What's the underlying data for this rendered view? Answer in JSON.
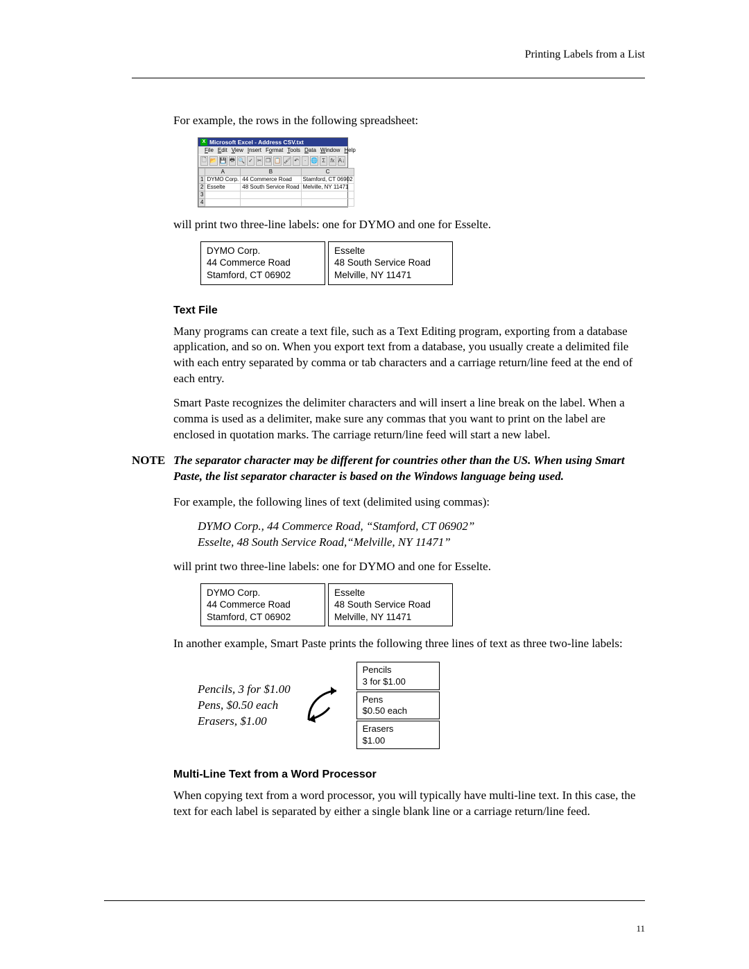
{
  "header": {
    "section_title": "Printing Labels from a List"
  },
  "body": {
    "p1": "For example, the rows in the following spreadsheet:",
    "p2": "will print two three-line labels: one for DYMO and one for Esselte.",
    "textfile_heading": "Text File",
    "p3": "Many programs can create a text file, such as a Text Editing program, exporting from a database application, and so on. When you export text from a database, you usually create a delimited file with each entry separated by comma or tab characters and a carriage return/line feed at the end of each entry.",
    "p4": "Smart Paste recognizes the delimiter characters and will insert a line break on the label. When a comma is used as a delimiter, make sure any commas that you want to print on the label are enclosed in quotation marks. The carriage return/line feed will start a new label.",
    "note_label": "NOTE",
    "note_text": "The separator character may be different for countries other than the US. When using Smart Paste, the list separator character is based on the Windows language being used.",
    "p5": "For example, the following lines of text (delimited using commas):",
    "csv_line1": "DYMO Corp., 44 Commerce Road, “Stamford, CT 06902”",
    "csv_line2": "Esselte, 48 South Service Road,“Melville, NY 11471”",
    "p6": "will print two three-line labels: one for DYMO and one for Esselte.",
    "p7": "In another example, Smart Paste prints the following three lines of text as three two-line labels:",
    "sp_source1": "Pencils, 3 for $1.00",
    "sp_source2": "Pens, $0.50 each",
    "sp_source3": "Erasers, $1.00",
    "multiline_heading": "Multi-Line Text from a Word Processor",
    "p8": "When copying text from a word processor, you will typically have multi-line text. In this case, the text for each label is separated by either a single blank line or a carriage return/line feed."
  },
  "excel": {
    "title": "Microsoft Excel - Address CSV.txt",
    "menu": [
      "File",
      "Edit",
      "View",
      "Insert",
      "Format",
      "Tools",
      "Data",
      "Window",
      "Help"
    ],
    "columns": [
      "A",
      "B",
      "C"
    ],
    "rows": [
      {
        "n": "1",
        "a": "DYMO Corp.",
        "b": "44 Commerce Road",
        "c": "Stamford, CT 06902"
      },
      {
        "n": "2",
        "a": "Esselte",
        "b": "48 South Service Road",
        "c": "Melville, NY 11471"
      },
      {
        "n": "3",
        "a": "",
        "b": "",
        "c": ""
      },
      {
        "n": "4",
        "a": "",
        "b": "",
        "c": ""
      }
    ]
  },
  "labels": {
    "dymo": {
      "l1": "DYMO Corp.",
      "l2": "44 Commerce Road",
      "l3": "Stamford, CT 06902"
    },
    "esselte": {
      "l1": "Esselte",
      "l2": "48 South Service Road",
      "l3": "Melville, NY 11471"
    }
  },
  "smartpaste_labels": [
    {
      "l1": "Pencils",
      "l2": "3 for $1.00"
    },
    {
      "l1": "Pens",
      "l2": "$0.50 each"
    },
    {
      "l1": "Erasers",
      "l2": "$1.00"
    }
  ],
  "page_number": "11"
}
